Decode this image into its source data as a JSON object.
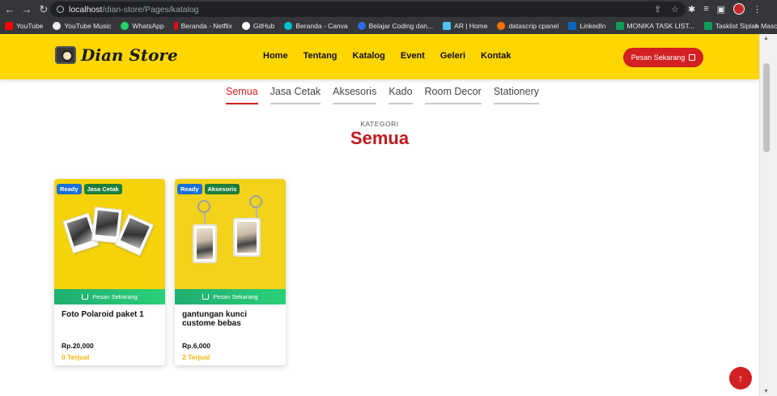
{
  "browser": {
    "url_host": "localhost",
    "url_path": "/dian-store/Pages/katalog",
    "bookmarks": [
      {
        "label": "YouTube",
        "color": "#ff0000"
      },
      {
        "label": "YouTube Music",
        "color": "#ffffff"
      },
      {
        "label": "WhatsApp",
        "color": "#25d366"
      },
      {
        "label": "Beranda - Netflix",
        "color": "#e50914"
      },
      {
        "label": "GitHub",
        "color": "#ffffff"
      },
      {
        "label": "Beranda - Canva",
        "color": "#00c4cc"
      },
      {
        "label": "Belajar Coding dan...",
        "color": "#2d6cdf"
      },
      {
        "label": "AR | Home",
        "color": "#4fc3f7"
      },
      {
        "label": "datascrip cpanel",
        "color": "#ff6f00"
      },
      {
        "label": "LinkedIn",
        "color": "#0a66c2"
      },
      {
        "label": "MONIKA TASK LIST...",
        "color": "#0f9d58"
      },
      {
        "label": "Tasklist Siplah Masc...",
        "color": "#0f9d58"
      }
    ],
    "more": "»"
  },
  "header": {
    "logo_text": "Dian Store",
    "nav": [
      "Home",
      "Tentang",
      "Katalog",
      "Event",
      "Geleri",
      "Kontak"
    ],
    "cta": "Pesan Sekarang"
  },
  "categories": {
    "tabs": [
      "Semua",
      "Jasa Cetak",
      "Aksesoris",
      "Kado",
      "Room Decor",
      "Stationery"
    ],
    "active": "Semua"
  },
  "section": {
    "kicker": "KATEGORI",
    "title": "Semua"
  },
  "products": [
    {
      "badge_status": "Ready",
      "badge_category": "Jasa Cetak",
      "order_label": "Pesan Sekarang",
      "name": "Foto Polaroid paket 1",
      "price": "Rp.20,000",
      "sold": "0 Terjual"
    },
    {
      "badge_status": "Ready",
      "badge_category": "Aksesoris",
      "order_label": "Pesan Sekarang",
      "name": "gantungan kunci custome bebas",
      "price": "Rp.6,000",
      "sold": "2 Terjual"
    }
  ],
  "colors": {
    "brand_yellow": "#ffd600",
    "brand_red": "#d32023",
    "order_green": "#22c06f",
    "sold_gold": "#f2b705"
  }
}
